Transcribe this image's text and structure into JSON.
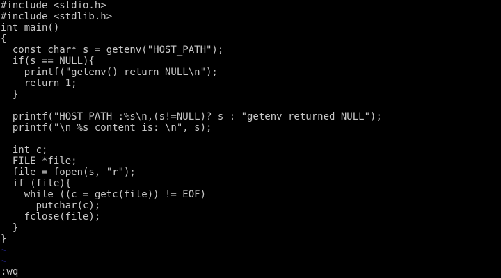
{
  "editor": {
    "lines": [
      "#include <stdio.h>",
      "#include <stdlib.h>",
      "int main()",
      "{",
      "  const char* s = getenv(\"HOST_PATH\");",
      "  if(s == NULL){",
      "    printf(\"getenv() return NULL\\n\");",
      "    return 1;",
      "  }",
      "",
      "  printf(\"HOST_PATH :%s\\n,(s!=NULL)? s : \"getenv returned NULL\");",
      "  printf(\"\\n %s content is: \\n\", s);",
      "",
      "  int c;",
      "  FILE *file;",
      "  file = fopen(s, \"r\");",
      "  if (file){",
      "    while ((c = getc(file)) != EOF)",
      "      putchar(c);",
      "    fclose(file);",
      "  }",
      "}"
    ],
    "empty_line_markers": [
      "~",
      "~"
    ],
    "command_line": ":wq",
    "colors": {
      "background": "#000000",
      "text": "#c8c8c8",
      "tilde": "#3838d8"
    }
  }
}
